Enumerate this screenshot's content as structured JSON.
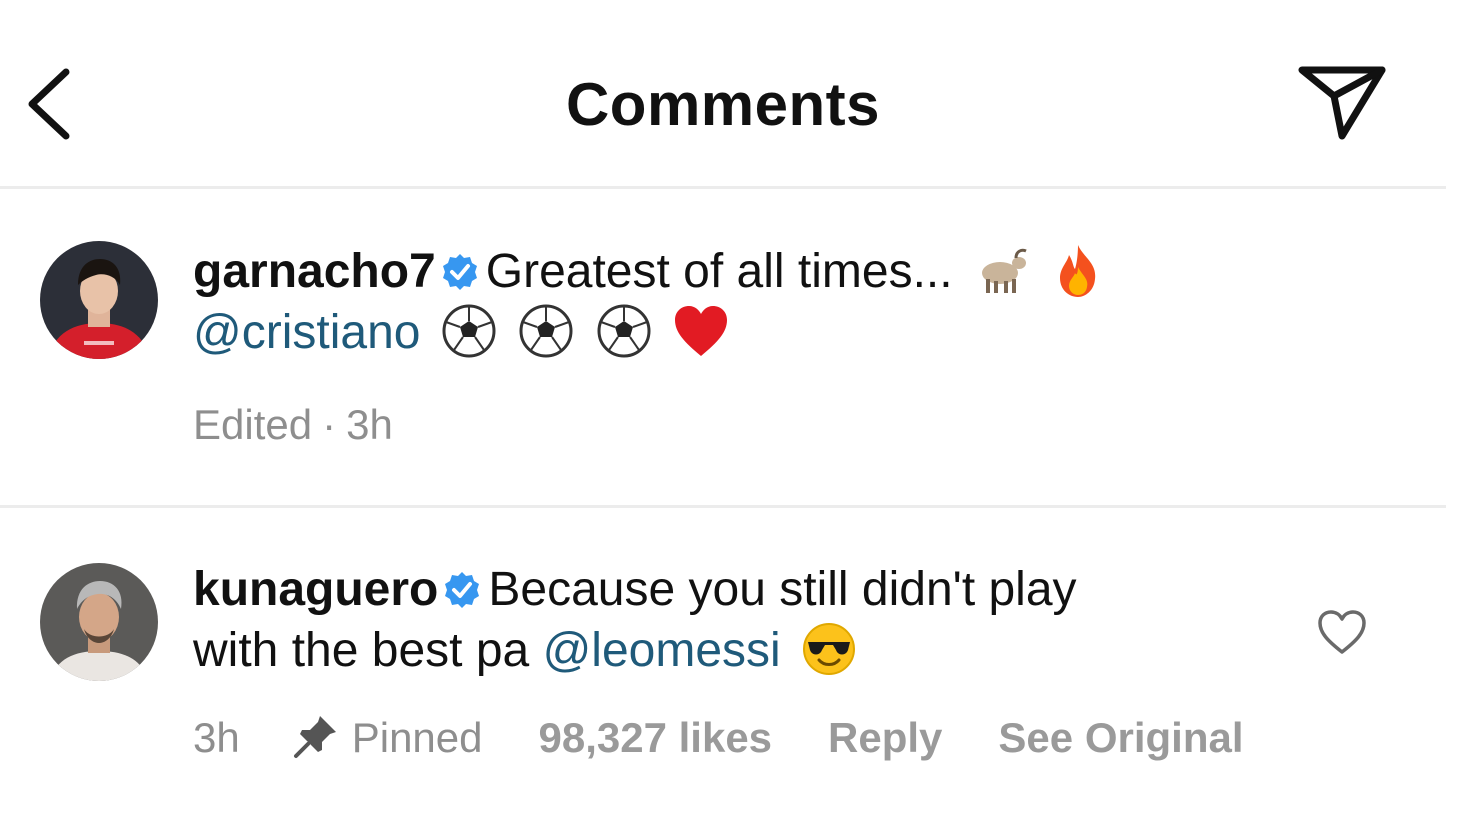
{
  "header": {
    "title": "Comments",
    "back_icon": "chevron-left-icon",
    "send_icon": "paper-plane-icon"
  },
  "comments": [
    {
      "username": "garnacho7",
      "verified": true,
      "text": "Greatest of all times...",
      "emojis_line1": [
        "goat-emoji",
        "fire-emoji"
      ],
      "mention": "@cristiano",
      "emojis_line2": [
        "soccer-ball-emoji",
        "soccer-ball-emoji",
        "soccer-ball-emoji",
        "red-heart-emoji"
      ],
      "edited": "Edited",
      "time": "3h"
    },
    {
      "username": "kunaguero",
      "verified": true,
      "text_line1": "Because you still didn't play",
      "text_line2": "with the best pa",
      "mention": "@leomessi",
      "emojis": [
        "sunglasses-face-emoji"
      ],
      "time": "3h",
      "pinned": "Pinned",
      "likes": "98,327 likes",
      "reply": "Reply",
      "see_original": "See Original"
    }
  ],
  "colors": {
    "mention": "#1f5a7a",
    "meta": "#8e8e8e",
    "verified": "#3797f0",
    "divider": "#ececec"
  }
}
